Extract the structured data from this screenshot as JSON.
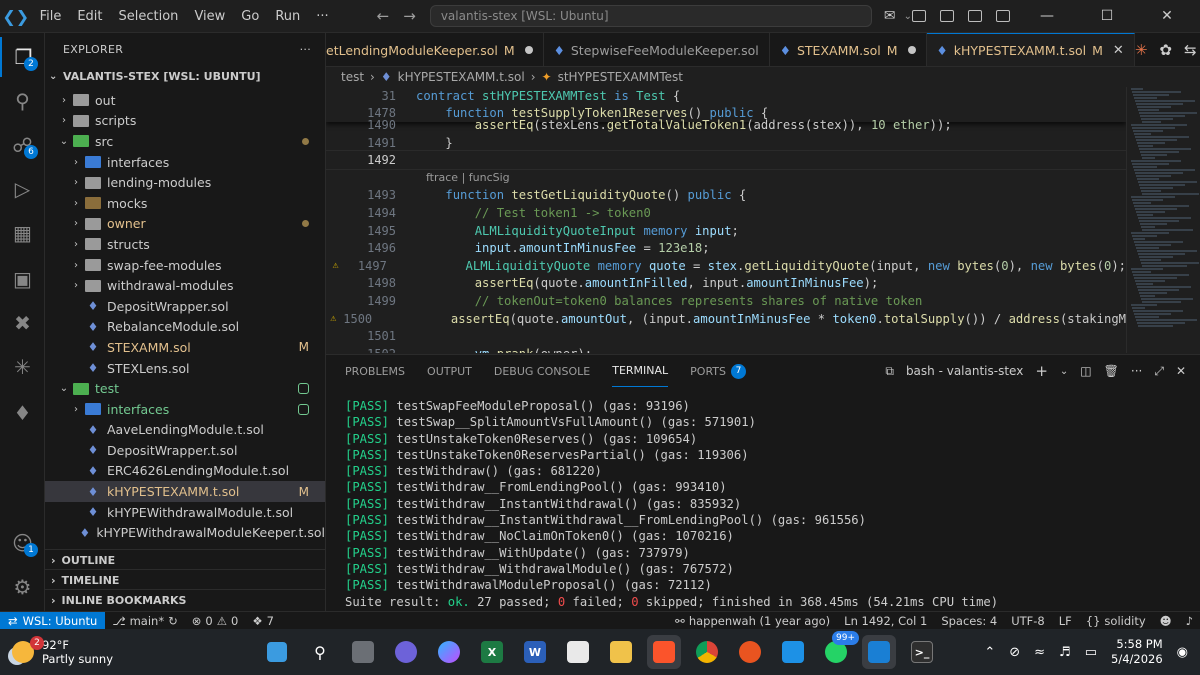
{
  "titlebar": {
    "menu": [
      "File",
      "Edit",
      "Selection",
      "View",
      "Go",
      "Run",
      "···"
    ],
    "command_center": "valantis-stex [WSL: Ubuntu]"
  },
  "activity": {
    "explorer_badge": "2",
    "scm_badge": "6",
    "accounts_badge": "1"
  },
  "explorer": {
    "title": "EXPLORER",
    "workspace": "VALANTIS-STEX [WSL: UBUNTU]",
    "tree": [
      {
        "label": "out",
        "indent": 1,
        "kind": "folder",
        "state": "closed",
        "color": "gray"
      },
      {
        "label": "scripts",
        "indent": 1,
        "kind": "folder",
        "state": "closed",
        "color": "gray"
      },
      {
        "label": "src",
        "indent": 1,
        "kind": "folder",
        "state": "open",
        "color": "green",
        "status": "dot"
      },
      {
        "label": "interfaces",
        "indent": 2,
        "kind": "folder",
        "state": "closed",
        "color": "blue"
      },
      {
        "label": "lending-modules",
        "indent": 2,
        "kind": "folder",
        "state": "closed",
        "color": "gray"
      },
      {
        "label": "mocks",
        "indent": 2,
        "kind": "folder",
        "state": "closed",
        "color": "brown"
      },
      {
        "label": "owner",
        "indent": 2,
        "kind": "folder",
        "state": "closed",
        "color": "gray",
        "status": "dot",
        "modified": true
      },
      {
        "label": "structs",
        "indent": 2,
        "kind": "folder",
        "state": "closed",
        "color": "gray"
      },
      {
        "label": "swap-fee-modules",
        "indent": 2,
        "kind": "folder",
        "state": "closed",
        "color": "gray"
      },
      {
        "label": "withdrawal-modules",
        "indent": 2,
        "kind": "folder",
        "state": "closed",
        "color": "gray"
      },
      {
        "label": "DepositWrapper.sol",
        "indent": 2,
        "kind": "file"
      },
      {
        "label": "RebalanceModule.sol",
        "indent": 2,
        "kind": "file"
      },
      {
        "label": "STEXAMM.sol",
        "indent": 2,
        "kind": "file",
        "modified": true,
        "status": "M"
      },
      {
        "label": "STEXLens.sol",
        "indent": 2,
        "kind": "file"
      },
      {
        "label": "test",
        "indent": 1,
        "kind": "folder",
        "state": "open",
        "color": "green",
        "status": "sq",
        "green": true
      },
      {
        "label": "interfaces",
        "indent": 2,
        "kind": "folder",
        "state": "closed",
        "color": "blue",
        "status": "sq",
        "green": true
      },
      {
        "label": "AaveLendingModule.t.sol",
        "indent": 2,
        "kind": "file"
      },
      {
        "label": "DepositWrapper.t.sol",
        "indent": 2,
        "kind": "file"
      },
      {
        "label": "ERC4626LendingModule.t.sol",
        "indent": 2,
        "kind": "file"
      },
      {
        "label": "kHYPESTEXAMM.t.sol",
        "indent": 2,
        "kind": "file",
        "modified": true,
        "status": "M",
        "selected": true
      },
      {
        "label": "kHYPEWithdrawalModule.t.sol",
        "indent": 2,
        "kind": "file"
      },
      {
        "label": "kHYPEWithdrawalModuleKeeper.t.sol",
        "indent": 2,
        "kind": "file"
      }
    ],
    "outline": "OUTLINE",
    "timeline": "TIMELINE",
    "bookmarks": "INLINE BOOKMARKS"
  },
  "tabs": [
    {
      "label": "etLendingModuleKeeper.sol",
      "mark": "M",
      "after": "dot",
      "active": false
    },
    {
      "label": "StepwiseFeeModuleKeeper.sol",
      "mark": "",
      "after": "",
      "active": false
    },
    {
      "label": "STEXAMM.sol",
      "mark": "M",
      "after": "dot",
      "active": false
    },
    {
      "label": "kHYPESTEXAMM.t.sol",
      "mark": "M",
      "after": "close",
      "active": true
    }
  ],
  "breadcrumb": [
    "test",
    "kHYPESTEXAMM.t.sol",
    "stHYPESTEXAMMTest"
  ],
  "code": {
    "sticky": [
      {
        "ln": "31",
        "tokens": [
          [
            "k",
            "contract "
          ],
          [
            "t",
            "stHYPESTEXAMMTest "
          ],
          [
            "k",
            "is "
          ],
          [
            "t",
            "Test "
          ],
          [
            "",
            "{"
          ]
        ]
      },
      {
        "ln": "1478",
        "tokens": [
          [
            "",
            "    "
          ],
          [
            "k",
            "function "
          ],
          [
            "f",
            "testSupplyToken1Reserves"
          ],
          [
            "",
            "() "
          ],
          [
            "k",
            "public "
          ],
          [
            "",
            "{"
          ]
        ]
      }
    ],
    "lines": [
      {
        "ln": "1490",
        "tokens": [
          [
            "",
            "        "
          ],
          [
            "f",
            "assertEq"
          ],
          [
            "",
            "(stexLens."
          ],
          [
            "f",
            "getTotalValueToken1"
          ],
          [
            "",
            "(address(stex)), "
          ],
          [
            "n",
            "10 ether"
          ],
          [
            "",
            "));"
          ]
        ]
      },
      {
        "ln": "1491",
        "tokens": [
          [
            "",
            "    }"
          ]
        ]
      },
      {
        "ln": "1492",
        "tokens": [
          [
            "",
            ""
          ]
        ],
        "current": true
      },
      {
        "lens": "ftrace | funcSig"
      },
      {
        "ln": "1493",
        "tokens": [
          [
            "",
            "    "
          ],
          [
            "k",
            "function "
          ],
          [
            "f",
            "testGetLiquidityQuote"
          ],
          [
            "",
            "() "
          ],
          [
            "k",
            "public "
          ],
          [
            "",
            "{"
          ]
        ]
      },
      {
        "ln": "1494",
        "tokens": [
          [
            "",
            "        "
          ],
          [
            "c",
            "// Test token1 -> token0"
          ]
        ]
      },
      {
        "ln": "1495",
        "tokens": [
          [
            "",
            "        "
          ],
          [
            "t",
            "ALMLiquidityQuoteInput "
          ],
          [
            "k",
            "memory "
          ],
          [
            "v",
            "input"
          ],
          [
            "",
            ";"
          ]
        ]
      },
      {
        "ln": "1496",
        "tokens": [
          [
            "",
            "        "
          ],
          [
            "v",
            "input"
          ],
          [
            "",
            "."
          ],
          [
            "v",
            "amountInMinusFee"
          ],
          [
            "",
            " = "
          ],
          [
            "n",
            "123e18"
          ],
          [
            "",
            ";"
          ]
        ]
      },
      {
        "ln": "1497",
        "warn": true,
        "tokens": [
          [
            "",
            "        "
          ],
          [
            "t",
            "ALMLiquidityQuote "
          ],
          [
            "k",
            "memory "
          ],
          [
            "v",
            "quote"
          ],
          [
            "",
            " = "
          ],
          [
            "v",
            "stex"
          ],
          [
            "",
            "."
          ],
          [
            "f",
            "getLiquidityQuote"
          ],
          [
            "",
            "(input, "
          ],
          [
            "k",
            "new "
          ],
          [
            "f",
            "bytes"
          ],
          [
            "",
            "("
          ],
          [
            "n",
            "0"
          ],
          [
            "",
            "), "
          ],
          [
            "k",
            "new "
          ],
          [
            "f",
            "bytes"
          ],
          [
            "",
            "("
          ],
          [
            "n",
            "0"
          ],
          [
            "",
            ");"
          ]
        ]
      },
      {
        "ln": "1498",
        "tokens": [
          [
            "",
            "        "
          ],
          [
            "f",
            "assertEq"
          ],
          [
            "",
            "(quote."
          ],
          [
            "v",
            "amountInFilled"
          ],
          [
            "",
            ", input."
          ],
          [
            "v",
            "amountInMinusFee"
          ],
          [
            "",
            ");"
          ]
        ]
      },
      {
        "ln": "1499",
        "tokens": [
          [
            "",
            "        "
          ],
          [
            "c",
            "// tokenOut=token0 balances represents shares of native token"
          ]
        ]
      },
      {
        "ln": "1500",
        "warn": true,
        "tokens": [
          [
            "",
            "        "
          ],
          [
            "f",
            "assertEq"
          ],
          [
            "",
            "(quote."
          ],
          [
            "v",
            "amountOut"
          ],
          [
            "",
            ", (input."
          ],
          [
            "v",
            "amountInMinusFee"
          ],
          [
            "",
            " * "
          ],
          [
            "v",
            "token0"
          ],
          [
            "",
            "."
          ],
          [
            "f",
            "totalSupply"
          ],
          [
            "",
            "()) / "
          ],
          [
            "f",
            "address"
          ],
          [
            "",
            "(stakingM"
          ]
        ]
      },
      {
        "ln": "1501",
        "tokens": [
          [
            "",
            ""
          ]
        ]
      },
      {
        "ln": "1502",
        "tokens": [
          [
            "",
            "        "
          ],
          [
            "v",
            "vm"
          ],
          [
            "",
            "."
          ],
          [
            "f",
            "prank"
          ],
          [
            "",
            "(owner);"
          ]
        ]
      }
    ]
  },
  "panel": {
    "tabs": [
      "PROBLEMS",
      "OUTPUT",
      "DEBUG CONSOLE",
      "TERMINAL",
      "PORTS"
    ],
    "active_tab": "TERMINAL",
    "ports_badge": "7",
    "shell": "bash - valantis-stex",
    "terminal": [
      {
        "tag": "[PASS]",
        "text": " testSwapFeeModuleProposal() (gas: 93196)"
      },
      {
        "tag": "[PASS]",
        "text": " testSwap__SplitAmountVsFullAmount() (gas: 571901)"
      },
      {
        "tag": "[PASS]",
        "text": " testUnstakeToken0Reserves() (gas: 109654)"
      },
      {
        "tag": "[PASS]",
        "text": " testUnstakeToken0ReservesPartial() (gas: 119306)"
      },
      {
        "tag": "[PASS]",
        "text": " testWithdraw() (gas: 681220)"
      },
      {
        "tag": "[PASS]",
        "text": " testWithdraw__FromLendingPool() (gas: 993410)"
      },
      {
        "tag": "[PASS]",
        "text": " testWithdraw__InstantWithdrawal() (gas: 835932)"
      },
      {
        "tag": "[PASS]",
        "text": " testWithdraw__InstantWithdrawal__FromLendingPool() (gas: 961556)"
      },
      {
        "tag": "[PASS]",
        "text": " testWithdraw__NoClaimOnToken0() (gas: 1070216)"
      },
      {
        "tag": "[PASS]",
        "text": " testWithdraw__WithUpdate() (gas: 737979)"
      },
      {
        "tag": "[PASS]",
        "text": " testWithdraw__WithdrawalModule() (gas: 767572)"
      },
      {
        "tag": "[PASS]",
        "text": " testWithdrawalModuleProposal() (gas: 72112)"
      }
    ],
    "suite": {
      "prefix": "Suite result: ",
      "ok": "ok.",
      "passed": " 27 passed; ",
      "failed_n": "0",
      "failed": " failed; ",
      "skipped_n": "0",
      "rest": " skipped; finished in 368.45ms (54.21ms CPU time)"
    }
  },
  "statusbar": {
    "remote": "WSL: Ubuntu",
    "branch": "main*",
    "errors": "0",
    "warnings": "0",
    "ports": "7",
    "blame": "happenwah (1 year ago)",
    "position": "Ln 1492, Col 1",
    "spaces": "Spaces: 4",
    "encoding": "UTF-8",
    "eol": "LF",
    "language": "solidity"
  },
  "taskbar": {
    "weather_badge": "2",
    "temp": "92°F",
    "condition": "Partly sunny",
    "whatsapp_badge": "99+",
    "time": "5:58 PM",
    "date": "5/4/2026"
  },
  "colors": {
    "accent": "#0078d4",
    "pass": "#23d18b",
    "modified": "#e2c08d",
    "untracked": "#73c991"
  }
}
